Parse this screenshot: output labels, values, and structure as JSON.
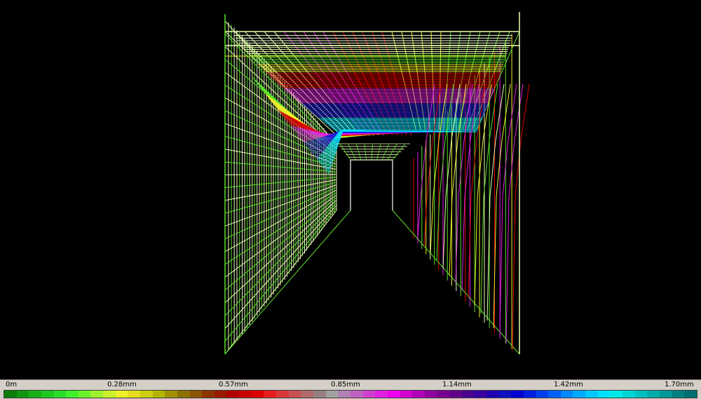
{
  "legend": {
    "ticks": [
      "0m",
      "0.28mm",
      "0.57mm",
      "0.85mm",
      "1.14mm",
      "1.42mm",
      "1.70mm"
    ],
    "colors": [
      "#0a7d0a",
      "#109610",
      "#17b017",
      "#1ec81e",
      "#2adc2a",
      "#40ee2a",
      "#6cf22c",
      "#9cf02c",
      "#ccf02c",
      "#f0f02a",
      "#e6dc20",
      "#cccc10",
      "#b4b400",
      "#a09000",
      "#8c7000",
      "#8c5400",
      "#8c3400",
      "#9a1800",
      "#b00000",
      "#c80000",
      "#dc0000",
      "#e61e1e",
      "#d83838",
      "#c85050",
      "#b06868",
      "#988080",
      "#a0a0a0",
      "#b080b0",
      "#c060c0",
      "#d040d0",
      "#e020e0",
      "#f000f0",
      "#d000d0",
      "#b000b8",
      "#9000a0",
      "#780090",
      "#600088",
      "#4c0090",
      "#3800a0",
      "#2000b0",
      "#1010c0",
      "#0000d0",
      "#0020e0",
      "#0040f0",
      "#0060ff",
      "#0088ff",
      "#00aaff",
      "#00c8ff",
      "#00e0ff",
      "#00e8e8",
      "#00d4d4",
      "#00c0c0",
      "#00acac",
      "#009898",
      "#008080",
      "#007070"
    ]
  },
  "viewport": {
    "background": "#000000",
    "structure": "wireframe-tunnel",
    "colors": {
      "near": "#f0ffd0",
      "green": "#5ce02c",
      "pale": "#e8ffb0",
      "yellow": "#f0f02a",
      "red": "#dc0000",
      "magenta": "#e020e0",
      "blue": "#2020e0",
      "cyan": "#00e0ff",
      "white": "#ffffff"
    }
  }
}
